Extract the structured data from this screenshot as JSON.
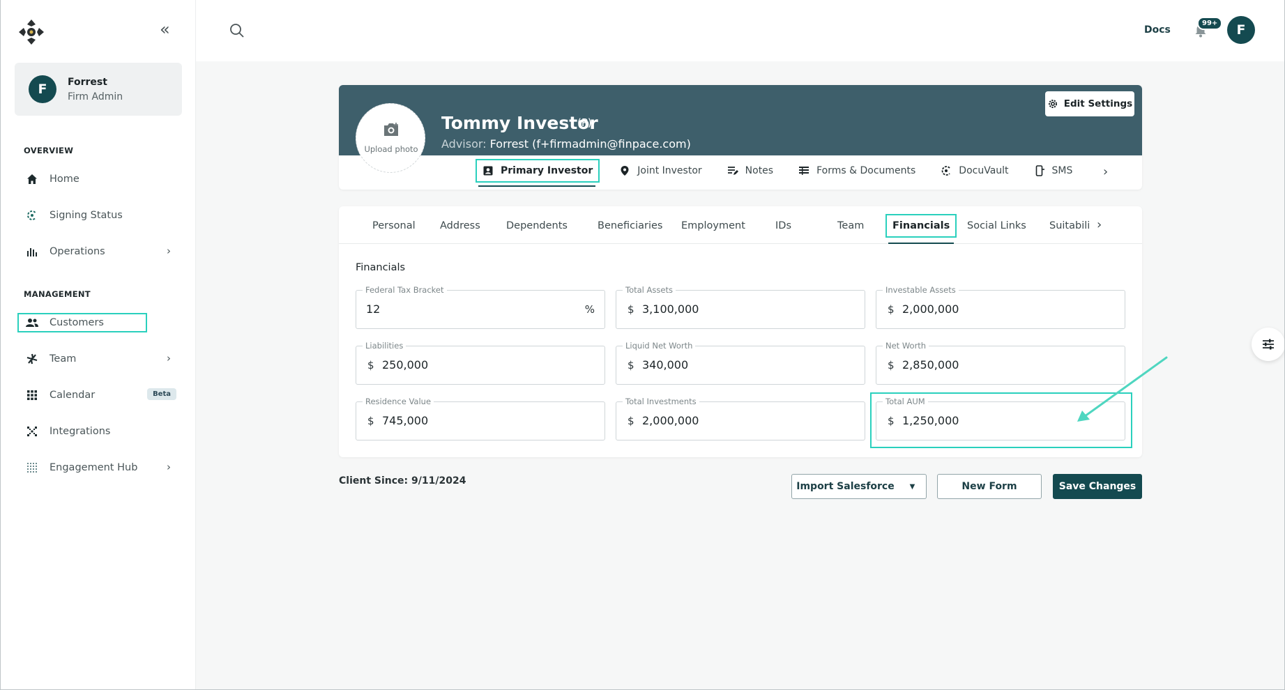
{
  "sidebar": {
    "user": {
      "initial": "F",
      "name": "Forrest",
      "role": "Firm Admin"
    },
    "overview_label": "OVERVIEW",
    "management_label": "MANAGEMENT",
    "items": [
      {
        "label": "Home",
        "icon": "home-icon"
      },
      {
        "label": "Signing Status",
        "icon": "signing-status-icon"
      },
      {
        "label": "Operations",
        "icon": "operations-icon"
      },
      {
        "label": "Customers",
        "icon": "customers-icon"
      },
      {
        "label": "Team",
        "icon": "team-icon"
      },
      {
        "label": "Calendar",
        "icon": "calendar-icon",
        "badge": "Beta"
      },
      {
        "label": "Integrations",
        "icon": "integrations-icon"
      },
      {
        "label": "Engagement Hub",
        "icon": "engagement-hub-icon"
      }
    ]
  },
  "topbar": {
    "docs_label": "Docs",
    "notification_count": "99+",
    "avatar_initial": "F"
  },
  "profile": {
    "name": "Tommy Investor",
    "tag": "(P)",
    "advisor_label": "Advisor:",
    "advisor_value": "Forrest (f+firmadmin@finpace.com)",
    "upload_photo_label": "Upload photo",
    "edit_settings_label": "Edit Settings",
    "tabs": [
      {
        "label": "Primary Investor"
      },
      {
        "label": "Joint Investor"
      },
      {
        "label": "Notes"
      },
      {
        "label": "Forms & Documents"
      },
      {
        "label": "DocuVault"
      },
      {
        "label": "SMS"
      }
    ]
  },
  "subtabs": [
    "Personal",
    "Address",
    "Dependents",
    "Beneficiaries",
    "Employment",
    "IDs",
    "Team",
    "Financials",
    "Social Links",
    "Suitabili"
  ],
  "financials": {
    "title": "Financials",
    "fields": [
      {
        "label": "Federal Tax Bracket",
        "prefix": "",
        "value": "12",
        "suffix": "%"
      },
      {
        "label": "Total Assets",
        "prefix": "$",
        "value": "3,100,000",
        "suffix": ""
      },
      {
        "label": "Investable Assets",
        "prefix": "$",
        "value": "2,000,000",
        "suffix": ""
      },
      {
        "label": "Liabilities",
        "prefix": "$",
        "value": "250,000",
        "suffix": ""
      },
      {
        "label": "Liquid Net Worth",
        "prefix": "$",
        "value": "340,000",
        "suffix": ""
      },
      {
        "label": "Net Worth",
        "prefix": "$",
        "value": "2,850,000",
        "suffix": ""
      },
      {
        "label": "Residence Value",
        "prefix": "$",
        "value": "745,000",
        "suffix": ""
      },
      {
        "label": "Total Investments",
        "prefix": "$",
        "value": "2,000,000",
        "suffix": ""
      },
      {
        "label": "Total AUM",
        "prefix": "$",
        "value": "1,250,000",
        "suffix": ""
      }
    ]
  },
  "footer": {
    "client_since": "Client Since: 9/11/2024",
    "import_label": "Import Salesforce",
    "new_form_label": "New Form",
    "save_label": "Save Changes"
  },
  "colors": {
    "brand": "#144a50",
    "banner": "#3e5f6b",
    "highlight": "#2ad0bd"
  }
}
